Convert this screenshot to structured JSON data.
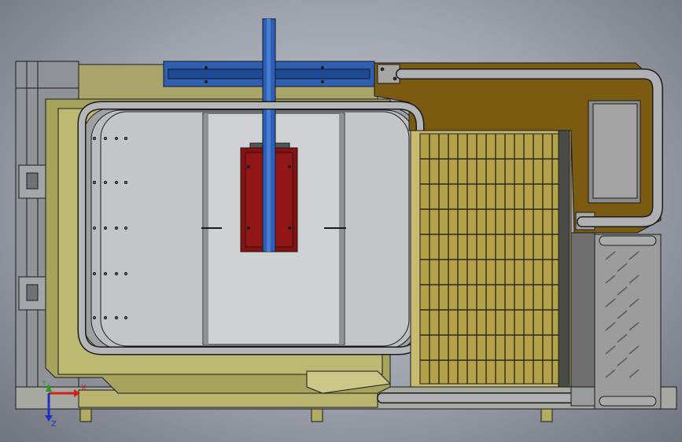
{
  "viewport": {
    "background_top": "#c9ccd4",
    "background_bottom": "#70747e"
  },
  "model": {
    "colors": {
      "frame_olive": "#8f8d4e",
      "frame_olive_light": "#b3b06b",
      "tank_gray": "#b9bbbf",
      "rail_blue": "#2e5fb0",
      "mast_blue": "#2d5fb8",
      "block_red": "#8a1010",
      "panel_brown": "#7b5a12",
      "pipe_gray": "#a9abad",
      "grate_yellow": "#b4a24a",
      "plate_gray": "#9c9c9c",
      "edge": "#1a1a1a"
    },
    "components": [
      "base-frame",
      "tank",
      "hot-water-tank",
      "vertical-mast",
      "gantry-rail",
      "heater-block",
      "pipe-loop",
      "filter-grate",
      "control-box",
      "floor-plate"
    ]
  },
  "triad": {
    "x_label": "X",
    "y_label": "Y",
    "z_label": "Z",
    "x_color": "#d02020",
    "y_color": "#20a020",
    "z_color": "#2030c0"
  }
}
